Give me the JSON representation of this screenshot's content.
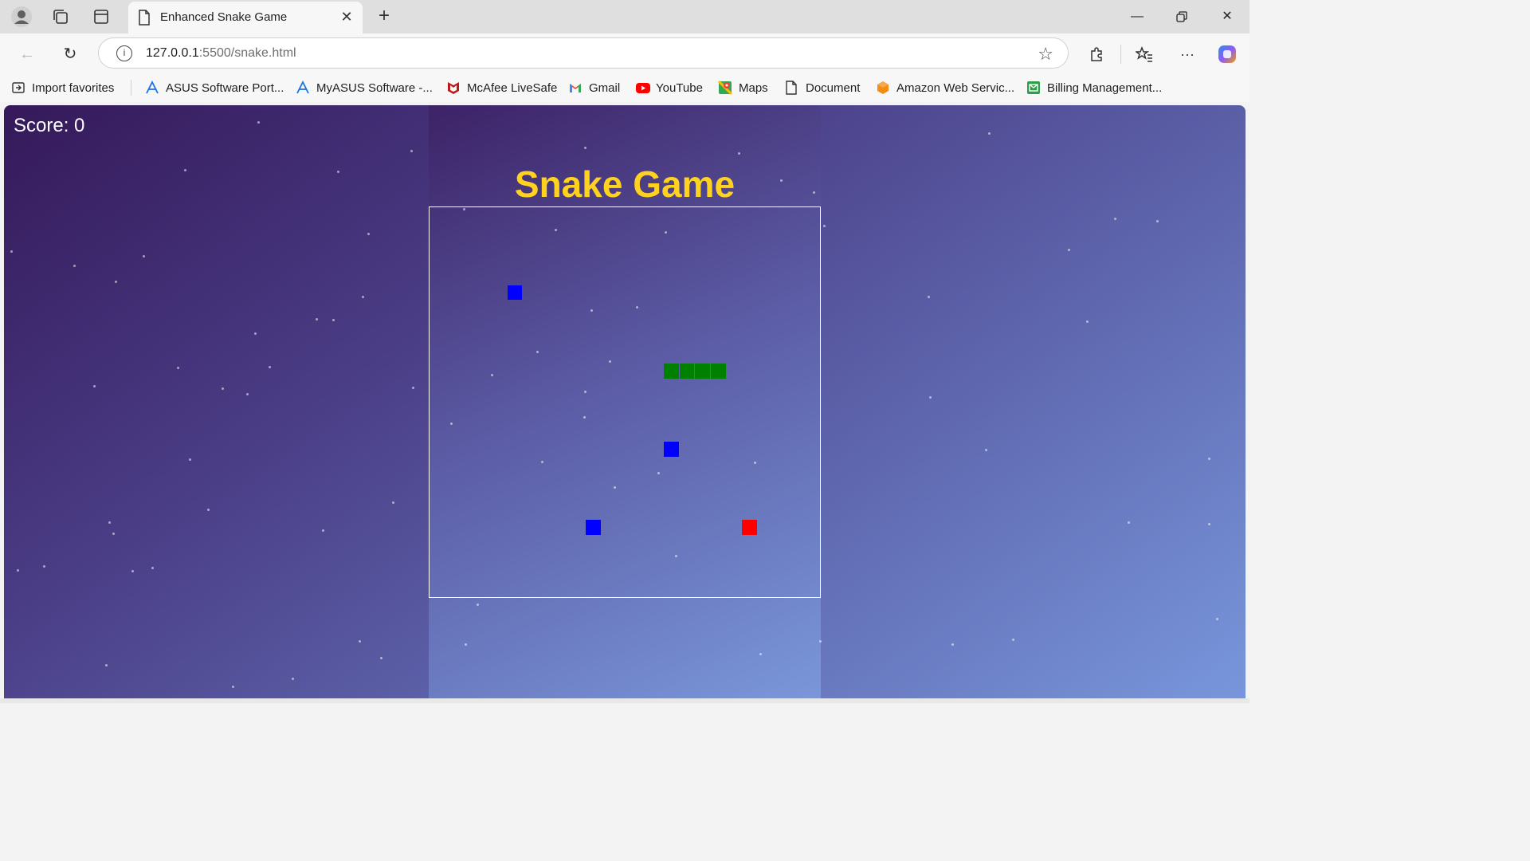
{
  "browser": {
    "tab_title": "Enhanced Snake Game",
    "url_host": "127.0.0.1",
    "url_path": ":5500/snake.html"
  },
  "favorites": [
    {
      "label": "Import favorites",
      "icon": "import-icon"
    },
    {
      "label": "ASUS Software Port...",
      "icon": "asus-icon"
    },
    {
      "label": "MyASUS Software -...",
      "icon": "asus-icon"
    },
    {
      "label": "McAfee LiveSafe",
      "icon": "mcafee-icon"
    },
    {
      "label": "Gmail",
      "icon": "gmail-icon"
    },
    {
      "label": "YouTube",
      "icon": "youtube-icon"
    },
    {
      "label": "Maps",
      "icon": "maps-icon"
    },
    {
      "label": "Document",
      "icon": "document-icon"
    },
    {
      "label": "Amazon Web Servic...",
      "icon": "aws-icon"
    },
    {
      "label": "Billing Management...",
      "icon": "billing-icon"
    }
  ],
  "game": {
    "score_text": "Score: 0",
    "title": "Snake Game",
    "title_color": "#ffd21f",
    "snake_color": "#008000",
    "obstacle_color": "#0000ff",
    "food_color": "#ff0000",
    "grid_cell_count": 25,
    "snake_cells": [
      [
        15,
        10
      ],
      [
        16,
        10
      ],
      [
        17,
        10
      ],
      [
        18,
        10
      ]
    ],
    "obstacle_cells": [
      [
        5,
        5
      ],
      [
        15,
        15
      ],
      [
        10,
        20
      ]
    ],
    "food_cell": [
      20,
      20
    ]
  }
}
